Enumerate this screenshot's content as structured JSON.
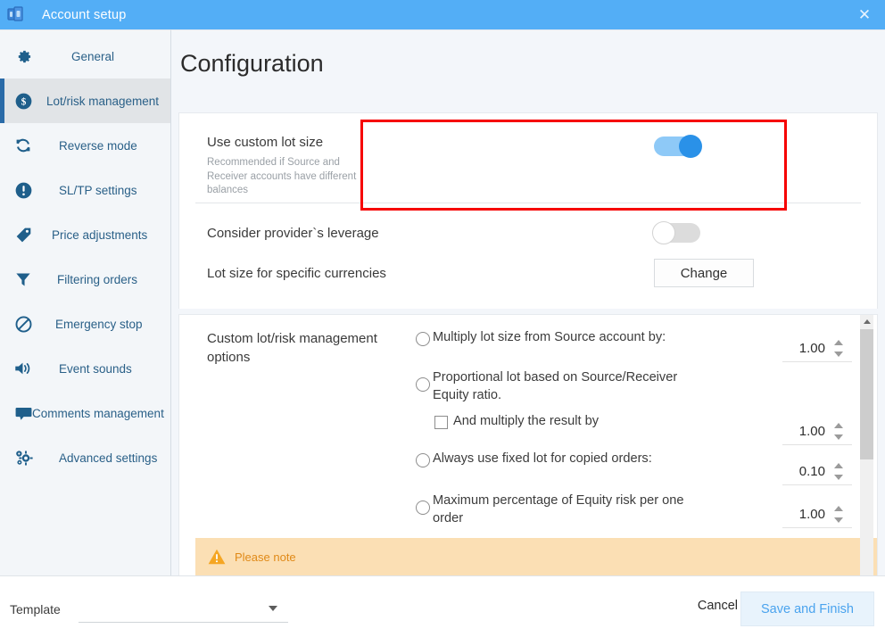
{
  "window": {
    "title": "Account setup",
    "app_icon": "copy-documents-icon",
    "close_label": "✕",
    "titlebar_color": "#53aef6"
  },
  "sidebar": {
    "items": [
      {
        "label": "General",
        "icon": "gear-icon",
        "active": false
      },
      {
        "label": "Lot/risk management",
        "icon": "dollar-circle-icon",
        "active": true
      },
      {
        "label": "Reverse mode",
        "icon": "refresh-arrows-icon",
        "active": false
      },
      {
        "label": "SL/TP settings",
        "icon": "exclamation-circle-icon",
        "active": false
      },
      {
        "label": "Price adjustments",
        "icon": "price-tag-icon",
        "active": false
      },
      {
        "label": "Filtering orders",
        "icon": "funnel-icon",
        "active": false
      },
      {
        "label": "Emergency stop",
        "icon": "no-entry-icon",
        "active": false
      },
      {
        "label": "Event sounds",
        "icon": "speaker-icon",
        "active": false
      },
      {
        "label": "Comments management",
        "icon": "speech-bubble-icon",
        "active": false
      },
      {
        "label": "Advanced settings",
        "icon": "gears-icon",
        "active": false
      }
    ],
    "active_accent": "#2a6ba8"
  },
  "main": {
    "page_title": "Configuration",
    "highlight_color": "#f60000",
    "settings": [
      {
        "label": "Use custom lot size",
        "sublabel": "Recommended if Source and Receiver accounts have different balances",
        "control": "toggle",
        "state": "on",
        "highlighted": true
      },
      {
        "label": "Consider provider`s leverage",
        "sublabel": "",
        "control": "toggle",
        "state": "off",
        "highlighted": false
      },
      {
        "label": "Lot size for specific currencies",
        "sublabel": "",
        "control": "button",
        "button_label": "Change",
        "highlighted": false
      }
    ],
    "options_group": {
      "title": "Custom lot/risk management options",
      "options": [
        {
          "type": "radio",
          "selected": false,
          "label": "Multiply lot size from Source account by:",
          "value": "1.00",
          "has_spinner": true
        },
        {
          "type": "radio",
          "selected": false,
          "label": "Proportional lot based on Source/Receiver Equity ratio.",
          "value": "",
          "has_spinner": false
        },
        {
          "type": "checkbox",
          "selected": false,
          "label": "And multiply the result by",
          "value": "1.00",
          "has_spinner": true,
          "indented": true
        },
        {
          "type": "radio",
          "selected": false,
          "label": "Always use fixed lot for copied orders:",
          "value": "0.10",
          "has_spinner": true
        },
        {
          "type": "radio",
          "selected": false,
          "label": "Maximum percentage of Equity risk per one order",
          "value": "1.00",
          "has_spinner": true
        }
      ]
    },
    "note": {
      "icon": "warning-triangle-icon",
      "text": "Please note",
      "background": "#fbdfb4",
      "text_color": "#e08a18"
    },
    "scrollbar": {
      "name": "vertical-scrollbar",
      "up_arrow": "▲"
    }
  },
  "footer": {
    "template_label": "Template",
    "template_value": "",
    "template_placeholder": "",
    "cancel_label": "Cancel",
    "save_label": "Save and Finish",
    "save_color": "#4aa3ee"
  }
}
